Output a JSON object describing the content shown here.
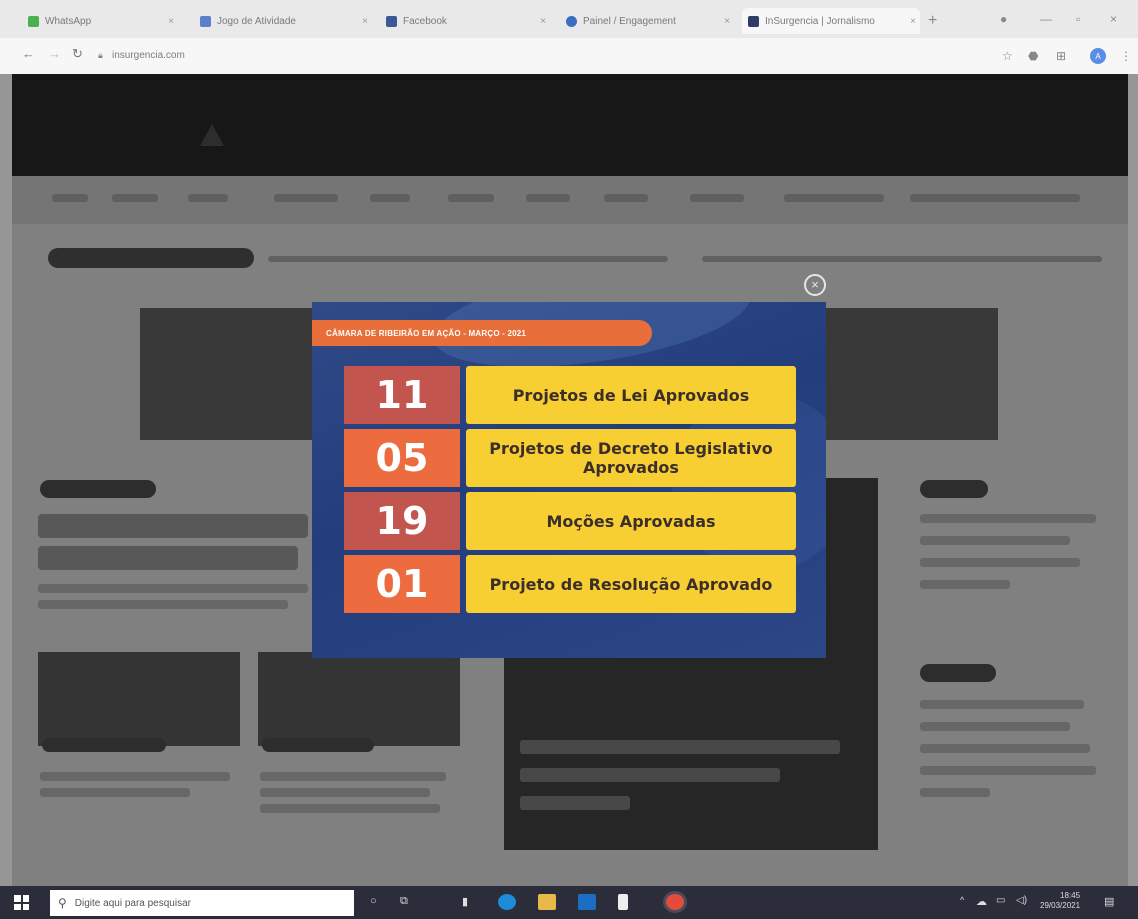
{
  "browser": {
    "tabs": [
      {
        "label": "WhatsApp"
      },
      {
        "label": "Jogo de Atividade"
      },
      {
        "label": "Facebook"
      },
      {
        "label": "Painel / Engagement"
      },
      {
        "label": "InSurgencia | Jornalismo"
      }
    ],
    "url": "insurgencia.com"
  },
  "modal": {
    "heading": "CÂMARA DE RIBEIRÃO EM AÇÃO - MARÇO - 2021",
    "close_symbol": "×",
    "stats": [
      {
        "number": "11",
        "label": "Projetos de Lei Aprovados",
        "color": "#c3554f"
      },
      {
        "number": "05",
        "label": "Projetos de Decreto Legislativo Aprovados",
        "color": "#ec6b3f"
      },
      {
        "number": "19",
        "label": "Moções Aprovadas",
        "color": "#c3554f"
      },
      {
        "number": "01",
        "label": "Projeto de Resolução Aprovado",
        "color": "#ec6b3f"
      }
    ]
  },
  "taskbar": {
    "search_placeholder": "Digite aqui para pesquisar",
    "time": "18:45",
    "date": "29/03/2021"
  },
  "colors": {
    "modal_bg": "#2a4482",
    "header_orange": "#e86e3a",
    "label_yellow": "#f7cf33"
  }
}
